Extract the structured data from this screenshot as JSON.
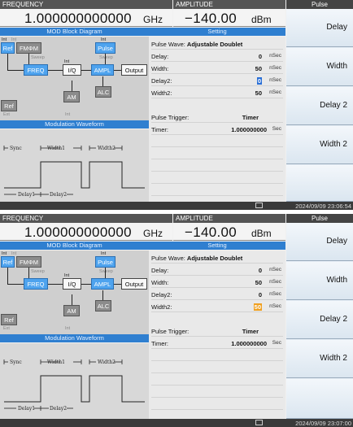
{
  "screens": [
    {
      "headers": {
        "frequency": "FREQUENCY",
        "amplitude": "AMPLITUDE",
        "menu": "Pulse"
      },
      "frequency": {
        "value": "1.000000000000",
        "unit": "GHz"
      },
      "amplitude": {
        "value": "−140.00",
        "unit": "dBm"
      },
      "softkeys": [
        "Delay",
        "Width",
        "Delay 2",
        "Width 2"
      ],
      "diagram": {
        "title": "MOD Block Diagram",
        "ref": "Ref",
        "ref_ext": "Ref",
        "ext": "Ext",
        "fm": "FMΦM",
        "pulse": "Pulse",
        "freq": "FREQ",
        "iq": "I/Q",
        "ampl": "AMPL",
        "output": "Output",
        "am": "AM",
        "alc": "ALC",
        "int": "Int",
        "sweep": "Sweep"
      },
      "waveform": {
        "title": "Modulation Waveform",
        "sync": "Sync",
        "width1": "Width1",
        "width2": "Width2",
        "delay1": "Delay1",
        "delay2": "Delay2"
      },
      "setting": {
        "title": "Setting",
        "pulse_wave_label": "Pulse Wave:",
        "pulse_wave_value": "Adjustable Doublet",
        "delay": {
          "label": "Delay:",
          "value": "0",
          "unit": "nSec"
        },
        "width": {
          "label": "Width:",
          "value": "50",
          "unit": "nSec"
        },
        "delay2": {
          "label": "Delay2:",
          "value": "0",
          "unit": "nSec"
        },
        "width2": {
          "label": "Width2:",
          "value": "50",
          "unit": "nSec"
        },
        "trigger": {
          "label": "Pulse Trigger:",
          "value": "Timer"
        },
        "timer": {
          "label": "Timer:",
          "value": "1.000000000",
          "unit": "Sec"
        }
      },
      "timestamp": "2024/09/09 23:06:54"
    },
    {
      "headers": {
        "frequency": "FREQUENCY",
        "amplitude": "AMPLITUDE",
        "menu": "Pulse"
      },
      "frequency": {
        "value": "1.000000000000",
        "unit": "GHz"
      },
      "amplitude": {
        "value": "−140.00",
        "unit": "dBm"
      },
      "softkeys": [
        "Delay",
        "Width",
        "Delay 2",
        "Width 2"
      ],
      "diagram": {
        "title": "MOD Block Diagram",
        "ref": "Ref",
        "ref_ext": "Ref",
        "ext": "Ext",
        "fm": "FMΦM",
        "pulse": "Pulse",
        "freq": "FREQ",
        "iq": "I/Q",
        "ampl": "AMPL",
        "output": "Output",
        "am": "AM",
        "alc": "ALC",
        "int": "Int",
        "sweep": "Sweep"
      },
      "waveform": {
        "title": "Modulation Waveform",
        "sync": "Sync",
        "width1": "Width1",
        "width2": "Width2",
        "delay1": "Delay1",
        "delay2": "Delay2"
      },
      "setting": {
        "title": "Setting",
        "pulse_wave_label": "Pulse Wave:",
        "pulse_wave_value": "Adjustable Doublet",
        "delay": {
          "label": "Delay:",
          "value": "0",
          "unit": "nSec"
        },
        "width": {
          "label": "Width:",
          "value": "50",
          "unit": "nSec"
        },
        "delay2": {
          "label": "Delay2:",
          "value": "0",
          "unit": "nSec"
        },
        "width2": {
          "label": "Width2:",
          "value": "50",
          "unit": "nSec"
        },
        "trigger": {
          "label": "Pulse Trigger:",
          "value": "Timer"
        },
        "timer": {
          "label": "Timer:",
          "value": "1.000000000",
          "unit": "Sec"
        }
      },
      "timestamp": "2024/09/09 23:07:00"
    }
  ]
}
